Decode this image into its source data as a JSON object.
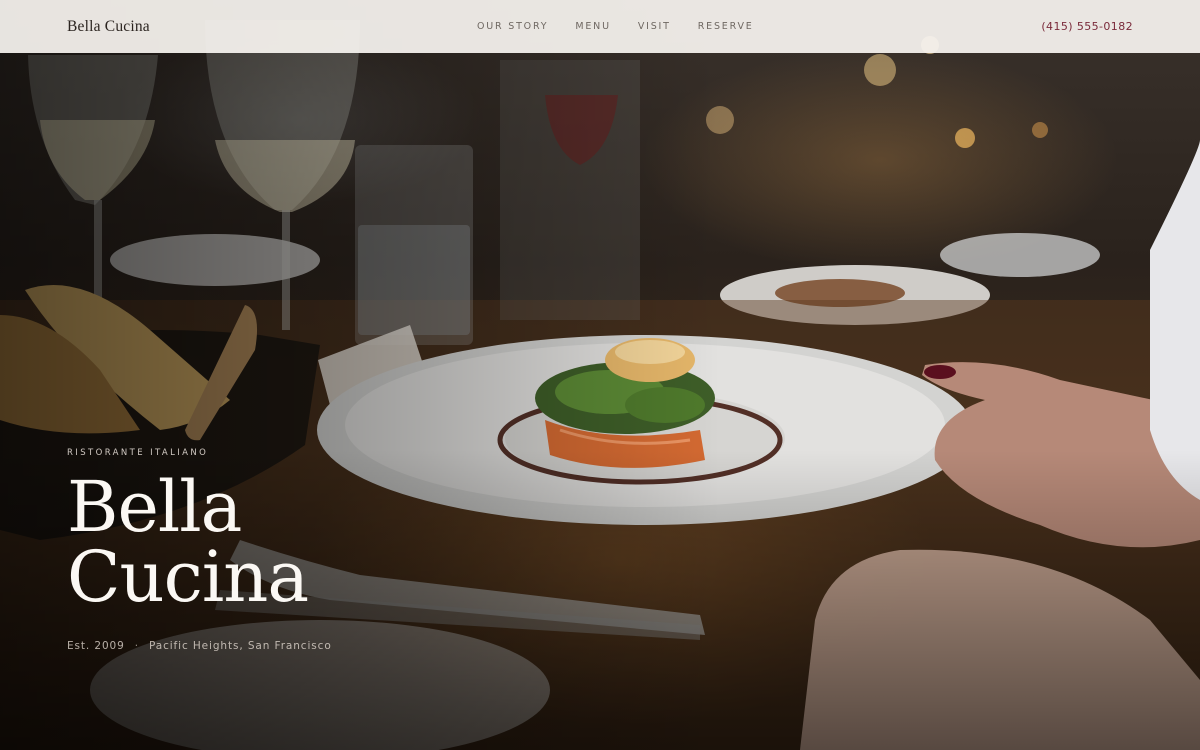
{
  "nav": {
    "brand": "Bella Cucina",
    "links": [
      "OUR STORY",
      "MENU",
      "VISIT",
      "RESERVE"
    ],
    "phone": "(415) 555-0182"
  },
  "hero": {
    "eyebrow": "RISTORANTE ITALIANO",
    "title_line1": "Bella",
    "title_line2": "Cucina",
    "established": "Est. 2009",
    "separator": "·",
    "location": "Pacific Heights, San Francisco",
    "image_description": "Restaurant dining table with plated dish, wine glasses and bread basket"
  },
  "colors": {
    "nav_background": "#f8f4f0",
    "phone_accent": "#7a2a3a",
    "hero_text": "#fbf8f4"
  }
}
